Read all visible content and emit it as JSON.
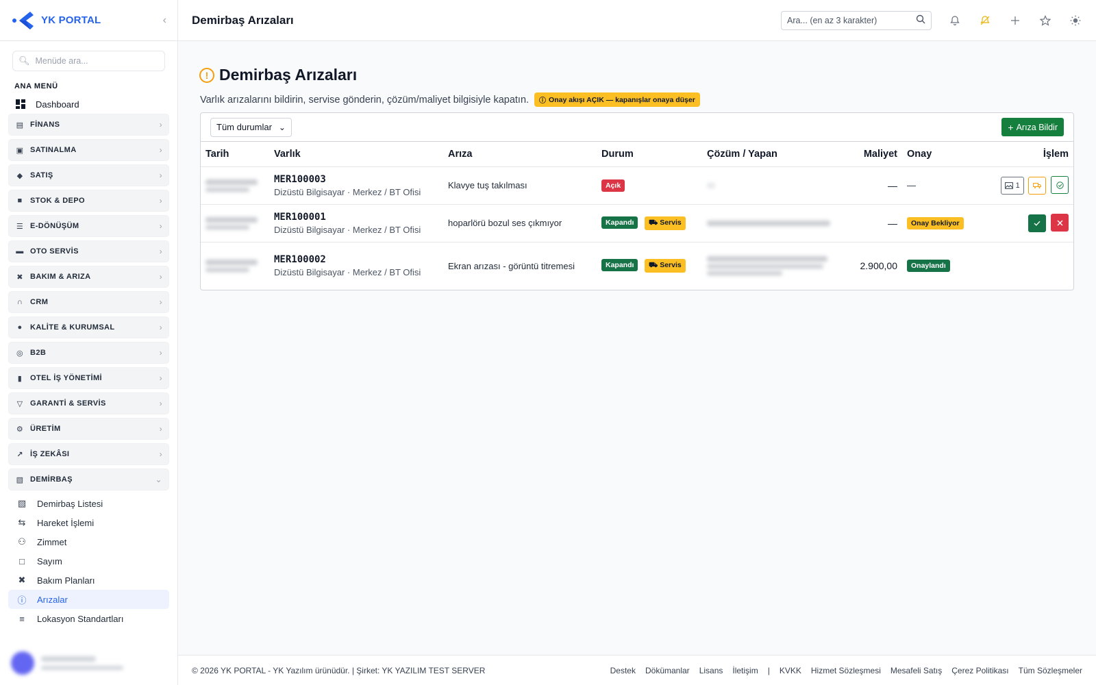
{
  "brand": {
    "name": "YK PORTAL"
  },
  "sidebar": {
    "search_placeholder": "Menüde ara...",
    "section_title": "ANA MENÜ",
    "dashboard": "Dashboard",
    "groups": [
      {
        "label": "FİNANS",
        "icon": "finance-icon"
      },
      {
        "label": "SATINALMA",
        "icon": "briefcase-icon"
      },
      {
        "label": "SATIŞ",
        "icon": "tag-icon"
      },
      {
        "label": "STOK & DEPO",
        "icon": "box-icon"
      },
      {
        "label": "E-DÖNÜŞÜM",
        "icon": "document-icon"
      },
      {
        "label": "OTO SERVİS",
        "icon": "car-icon"
      },
      {
        "label": "BAKIM & ARIZA",
        "icon": "tools-icon"
      },
      {
        "label": "CRM",
        "icon": "headset-icon"
      },
      {
        "label": "KALİTE & KURUMSAL",
        "icon": "quality-icon"
      },
      {
        "label": "B2B",
        "icon": "globe-icon"
      },
      {
        "label": "OTEL İŞ YÖNETİMİ",
        "icon": "building-icon"
      },
      {
        "label": "GARANTİ & SERVİS",
        "icon": "shield-icon"
      },
      {
        "label": "ÜRETİM",
        "icon": "gear-icon"
      },
      {
        "label": "İŞ ZEKÂSI",
        "icon": "chart-icon"
      },
      {
        "label": "DEMİRBAŞ",
        "icon": "cube-icon"
      }
    ],
    "sub_items": [
      {
        "label": "Demirbaş Listesi",
        "icon": "cube-icon"
      },
      {
        "label": "Hareket İşlemi",
        "icon": "arrows-icon"
      },
      {
        "label": "Zimmet",
        "icon": "person-icon"
      },
      {
        "label": "Sayım",
        "icon": "clipboard-icon"
      },
      {
        "label": "Bakım Planları",
        "icon": "tools-icon"
      },
      {
        "label": "Arızalar",
        "icon": "alert-icon"
      },
      {
        "label": "Lokasyon Standartları",
        "icon": "list-icon"
      }
    ],
    "active_sub": "Arızalar"
  },
  "topbar": {
    "title": "Demirbaş Arızaları",
    "search_placeholder": "Ara... (en az 3 karakter)"
  },
  "page": {
    "title": "Demirbaş Arızaları",
    "description": "Varlık arızalarını bildirin, servise gönderin, çözüm/maliyet bilgisiyle kapatın.",
    "flow_badge": "Onay akışı AÇIK — kapanışlar onaya düşer",
    "status_filter": "Tüm durumlar",
    "add_button": "Arıza Bildir"
  },
  "table": {
    "columns": [
      "Tarih",
      "Varlık",
      "Arıza",
      "Durum",
      "Çözüm / Yapan",
      "Maliyet",
      "Onay",
      "İşlem"
    ],
    "rows": [
      {
        "code": "MER100003",
        "asset_sub": "Dizüstü Bilgisayar · Merkez / BT Ofisi",
        "fault": "Klavye tuş takılması",
        "status": "Açık",
        "service": "",
        "cost": "—",
        "approval": "—",
        "photo_count": "1"
      },
      {
        "code": "MER100001",
        "asset_sub": "Dizüstü Bilgisayar · Merkez / BT Ofisi",
        "fault": "hoparlörü bozul ses çıkmıyor",
        "status": "Kapandı",
        "service": "Servis",
        "cost": "—",
        "approval": "Onay Bekliyor"
      },
      {
        "code": "MER100002",
        "asset_sub": "Dizüstü Bilgisayar · Merkez / BT Ofisi",
        "fault": "Ekran arızası - görüntü titremesi",
        "status": "Kapandı",
        "service": "Servis",
        "cost": "2.900,00",
        "approval": "Onaylandı"
      }
    ]
  },
  "footer": {
    "copyright": "© 2026 YK PORTAL - YK Yazılım ürünüdür. | Şirket: YK YAZILIM TEST SERVER",
    "links": [
      "Destek",
      "Dökümanlar",
      "Lisans",
      "İletişim"
    ],
    "separator": "|",
    "legal_links": [
      "KVKK",
      "Hizmet Sözleşmesi",
      "Mesafeli Satış",
      "Çerez Politikası",
      "Tüm Sözleşmeler"
    ]
  },
  "colors": {
    "brand": "#2563eb",
    "success": "#157347",
    "danger": "#dc3545",
    "warning": "#fbbf24"
  }
}
